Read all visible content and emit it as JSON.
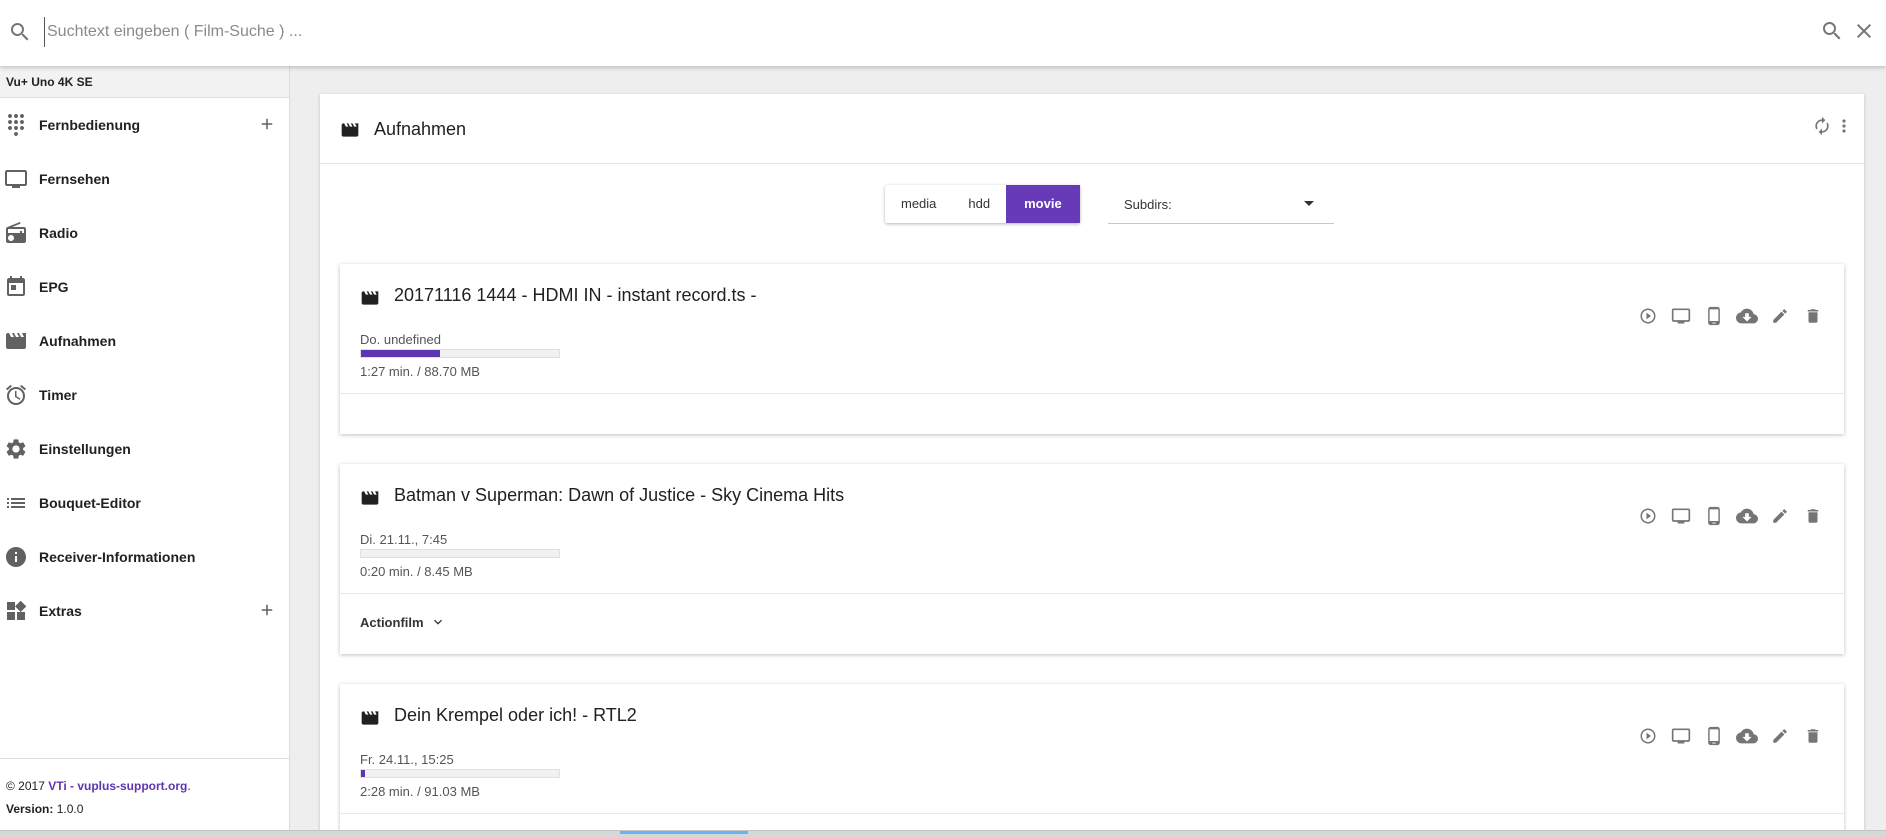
{
  "search": {
    "placeholder": "Suchtext eingeben ( Film-Suche ) ..."
  },
  "sidebar": {
    "device": "Vu+ Uno 4K SE",
    "items": [
      {
        "label": "Fernbedienung",
        "icon": "dialpad-icon",
        "expandable": true
      },
      {
        "label": "Fernsehen",
        "icon": "tv-icon",
        "expandable": false
      },
      {
        "label": "Radio",
        "icon": "radio-icon",
        "expandable": false
      },
      {
        "label": "EPG",
        "icon": "calendar-icon",
        "expandable": false
      },
      {
        "label": "Aufnahmen",
        "icon": "movie-icon",
        "expandable": false
      },
      {
        "label": "Timer",
        "icon": "alarm-icon",
        "expandable": false
      },
      {
        "label": "Einstellungen",
        "icon": "gear-icon",
        "expandable": false
      },
      {
        "label": "Bouquet-Editor",
        "icon": "list-icon",
        "expandable": false
      },
      {
        "label": "Receiver-Informationen",
        "icon": "info-icon",
        "expandable": false
      },
      {
        "label": "Extras",
        "icon": "dashboard-icon",
        "expandable": true
      }
    ],
    "footer": {
      "copyright": "© 2017",
      "link": "VTi - vuplus-support.org",
      "period": ".",
      "version_label": "Version:",
      "version": "1.0.0"
    }
  },
  "main": {
    "title": "Aufnahmen",
    "locations": [
      "media",
      "hdd",
      "movie"
    ],
    "active_location": "movie",
    "subdirs_label": "Subdirs:",
    "recordings": [
      {
        "title": "20171116 1444 - HDMI IN - instant record.ts -",
        "date": "Do. undefined",
        "progress": 0.4,
        "meta": "1:27 min. / 88.70 MB",
        "genre": ""
      },
      {
        "title": "Batman v Superman: Dawn of Justice - Sky Cinema Hits",
        "date": "Di. 21.11., 7:45",
        "progress": 0,
        "meta": "0:20 min. / 8.45 MB",
        "genre": "Actionfilm"
      },
      {
        "title": "Dein Krempel oder ich! - RTL2",
        "date": "Fr. 24.11., 15:25",
        "progress": 0.02,
        "meta": "2:28 min. / 91.03 MB",
        "genre": ""
      }
    ]
  },
  "colors": {
    "accent": "#673ab7",
    "progress": "#5e35b1",
    "link": "#5e35b1"
  }
}
